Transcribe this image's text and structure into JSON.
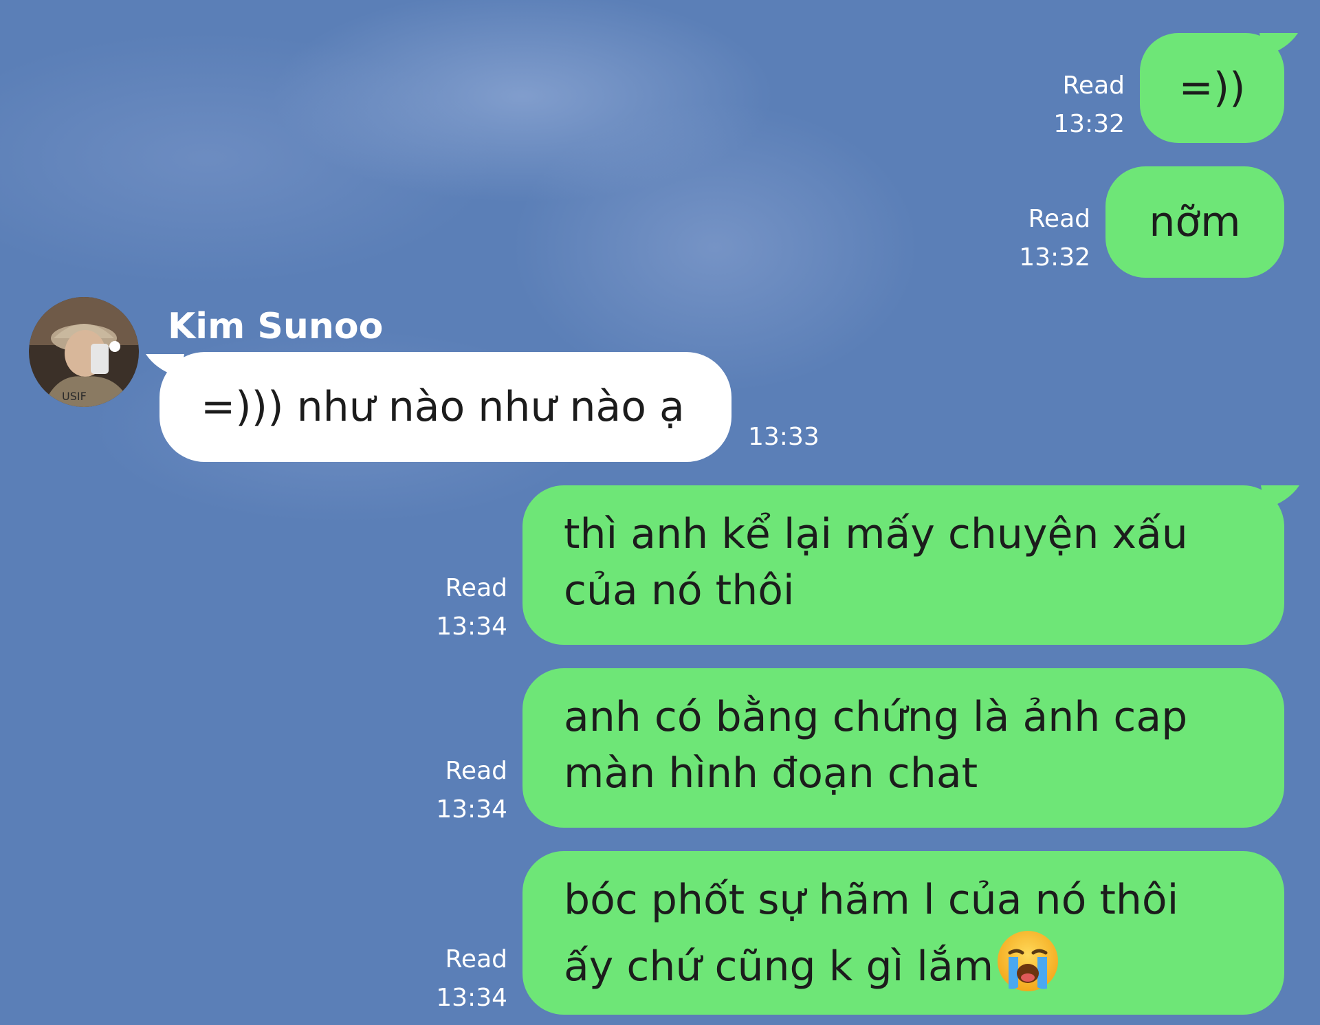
{
  "theme": {
    "outgoing_bubble": "#6ee677",
    "incoming_bubble": "#ffffff",
    "background": "#5b7fb7"
  },
  "contact": {
    "name": "Kim Sunoo",
    "avatar_icon": "profile-photo-avatar"
  },
  "messages": [
    {
      "direction": "outgoing",
      "text": "=))",
      "status": "Read",
      "time": "13:32"
    },
    {
      "direction": "outgoing",
      "text": "nỡm",
      "status": "Read",
      "time": "13:32"
    },
    {
      "direction": "incoming",
      "text": "=))) như nào như nào ạ",
      "time": "13:33"
    },
    {
      "direction": "outgoing",
      "text": "thì anh kể lại mấy chuyện xấu\ncủa nó thôi",
      "status": "Read",
      "time": "13:34"
    },
    {
      "direction": "outgoing",
      "text": "anh có bằng chứng là ảnh cap\nmàn hình đoạn chat",
      "status": "Read",
      "time": "13:34"
    },
    {
      "direction": "outgoing",
      "text_line1": "bóc phốt sự hãm l của nó thôi",
      "text_line2": "ấy chứ cũng k gì lắm",
      "emoji": "loudly-crying-face-emoji",
      "status": "Read",
      "time": "13:34"
    }
  ]
}
